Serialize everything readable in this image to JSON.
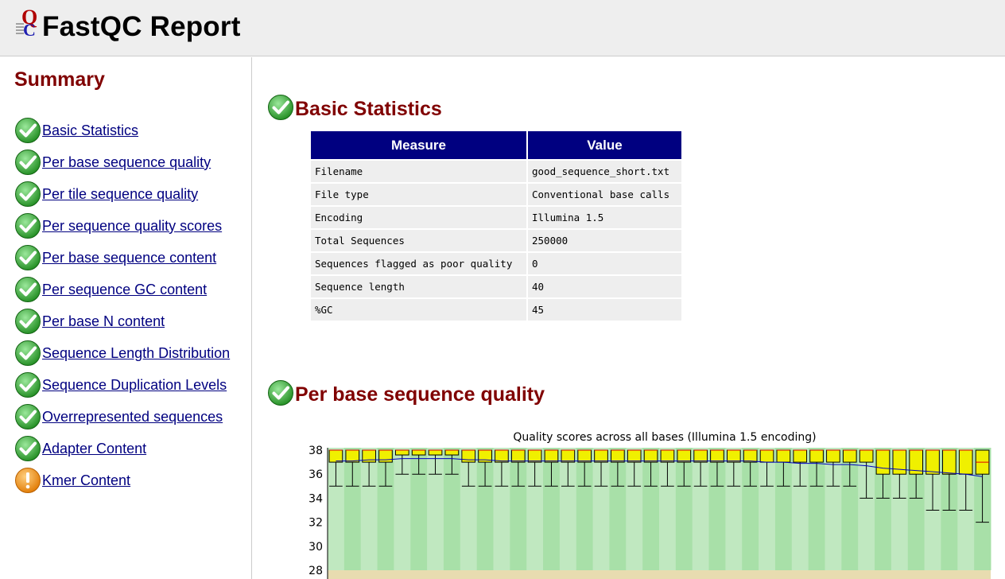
{
  "header": {
    "title": "FastQC Report",
    "logo_icon": "fastqc-logo-icon"
  },
  "summary": {
    "title": "Summary",
    "items": [
      {
        "label": "Basic Statistics",
        "status": "pass"
      },
      {
        "label": "Per base sequence quality",
        "status": "pass"
      },
      {
        "label": "Per tile sequence quality",
        "status": "pass"
      },
      {
        "label": "Per sequence quality scores",
        "status": "pass"
      },
      {
        "label": "Per base sequence content",
        "status": "pass"
      },
      {
        "label": "Per sequence GC content",
        "status": "pass"
      },
      {
        "label": "Per base N content",
        "status": "pass"
      },
      {
        "label": "Sequence Length Distribution",
        "status": "pass"
      },
      {
        "label": "Sequence Duplication Levels",
        "status": "pass"
      },
      {
        "label": "Overrepresented sequences",
        "status": "pass"
      },
      {
        "label": "Adapter Content",
        "status": "pass"
      },
      {
        "label": "Kmer Content",
        "status": "warn"
      }
    ]
  },
  "colors": {
    "pass": "#2aa52a",
    "warn": "#f08c10",
    "heading": "#800000",
    "link": "#000080",
    "table_header": "#000080"
  },
  "basic_statistics": {
    "title": "Basic Statistics",
    "status": "pass",
    "headers": {
      "measure": "Measure",
      "value": "Value"
    },
    "rows": [
      {
        "measure": "Filename",
        "value": "good_sequence_short.txt"
      },
      {
        "measure": "File type",
        "value": "Conventional base calls"
      },
      {
        "measure": "Encoding",
        "value": "Illumina 1.5"
      },
      {
        "measure": "Total Sequences",
        "value": "250000"
      },
      {
        "measure": "Sequences flagged as poor quality",
        "value": "0"
      },
      {
        "measure": "Sequence length",
        "value": "40"
      },
      {
        "measure": "%GC",
        "value": "45"
      }
    ]
  },
  "per_base_quality": {
    "title": "Per base sequence quality",
    "status": "pass"
  },
  "chart_data": {
    "type": "box",
    "title": "Quality scores across all bases (Illumina 1.5 encoding)",
    "y_ticks": [
      "38",
      "36",
      "34",
      "32",
      "30",
      "28"
    ],
    "ylim": [
      27.3,
      38.2
    ],
    "positions": 40,
    "q1": [
      37,
      37,
      37,
      37,
      37.6,
      37.6,
      37.6,
      37.6,
      37,
      37,
      37,
      37,
      37,
      37,
      37,
      37,
      37,
      37,
      37,
      37,
      37,
      37,
      37,
      37,
      37,
      37,
      37,
      37,
      37,
      37,
      37,
      37,
      37,
      36,
      36,
      36,
      36,
      36,
      36,
      36
    ],
    "q3": [
      38,
      38,
      38,
      38,
      38,
      38,
      38,
      38,
      38,
      38,
      38,
      38,
      38,
      38,
      38,
      38,
      38,
      38,
      38,
      38,
      38,
      38,
      38,
      38,
      38,
      38,
      38,
      38,
      38,
      38,
      38,
      38,
      38,
      38,
      38,
      38,
      38,
      38,
      38,
      38
    ],
    "median": [
      38,
      38,
      38,
      38,
      38,
      38,
      38,
      38,
      38,
      38,
      38,
      38,
      38,
      38,
      38,
      38,
      38,
      38,
      38,
      38,
      38,
      38,
      38,
      38,
      38,
      38,
      38,
      38,
      38,
      38,
      38,
      38,
      38,
      38,
      38,
      38,
      38,
      38,
      38,
      37
    ],
    "whisker_low": [
      35,
      35,
      35,
      35,
      36,
      36,
      36,
      36,
      35,
      35,
      35,
      35,
      35,
      35,
      35,
      35,
      35,
      35,
      35,
      35,
      35,
      35,
      35,
      35,
      35,
      35,
      35,
      35,
      35,
      35,
      35,
      35,
      34,
      34,
      34,
      34,
      33,
      33,
      33,
      32
    ],
    "mean": [
      37.1,
      37.1,
      37.2,
      37.2,
      37.3,
      37.3,
      37.3,
      37.3,
      37.2,
      37.2,
      37.1,
      37.1,
      37.1,
      37.1,
      37.1,
      37.1,
      37.1,
      37.1,
      37.1,
      37.1,
      37.1,
      37.1,
      37.1,
      37.1,
      37.1,
      37.1,
      37.0,
      37.0,
      36.9,
      36.9,
      36.8,
      36.8,
      36.7,
      36.5,
      36.4,
      36.3,
      36.2,
      36.1,
      36.0,
      35.8
    ],
    "bands": {
      "good": "#c0e8c0",
      "good_alt": "#a8e0a8",
      "medium": "#e8dcb0"
    },
    "box_color": "#f0f000",
    "mean_color": "#0000c0"
  }
}
